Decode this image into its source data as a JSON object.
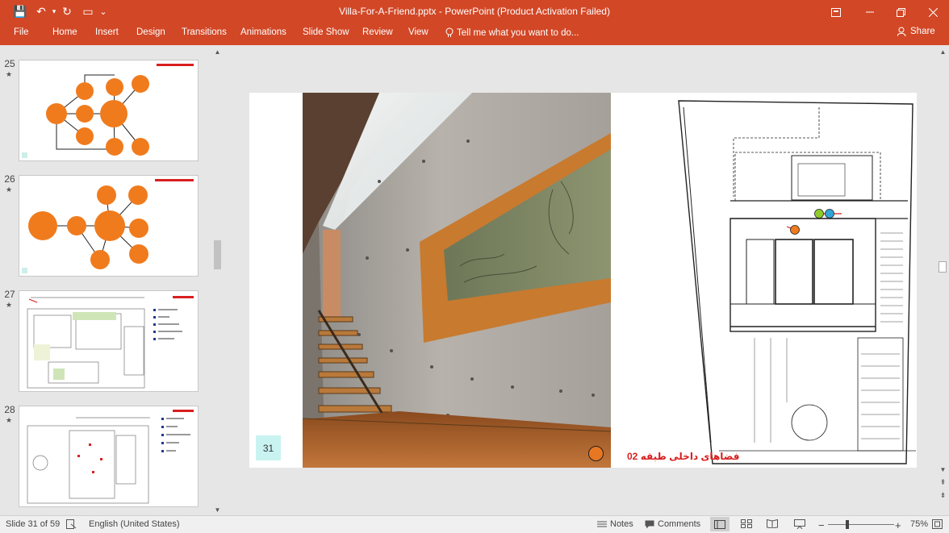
{
  "window": {
    "title": "Villa-For-A-Friend.pptx - PowerPoint (Product Activation Failed)",
    "restore_icon": "ribbon-display-icon",
    "min_icon": "minimize-icon",
    "max_icon": "restore-icon",
    "close_icon": "close-icon"
  },
  "quick_access": {
    "save": "💾",
    "undo": "↶",
    "redo": "↻",
    "present": "▭",
    "customize": "⌄"
  },
  "ribbon": {
    "tabs": [
      "File",
      "Home",
      "Insert",
      "Design",
      "Transitions",
      "Animations",
      "Slide Show",
      "Review",
      "View"
    ],
    "tell_me": "Tell me what you want to do...",
    "share": "Share"
  },
  "thumbnails": [
    {
      "number": "25",
      "star": "★"
    },
    {
      "number": "26",
      "star": "★"
    },
    {
      "number": "27",
      "star": "★"
    },
    {
      "number": "28",
      "star": "★"
    }
  ],
  "slide": {
    "page_number": "31",
    "caption": "فضاهای داخلی طبقه 02",
    "accent_color": "#e87722",
    "caption_color": "#d81f1f",
    "page_box_color": "#c9f3f1"
  },
  "status": {
    "slide_of": "Slide 31 of 59",
    "language": "English (United States)",
    "notes": "Notes",
    "comments": "Comments",
    "zoom": "75%"
  }
}
